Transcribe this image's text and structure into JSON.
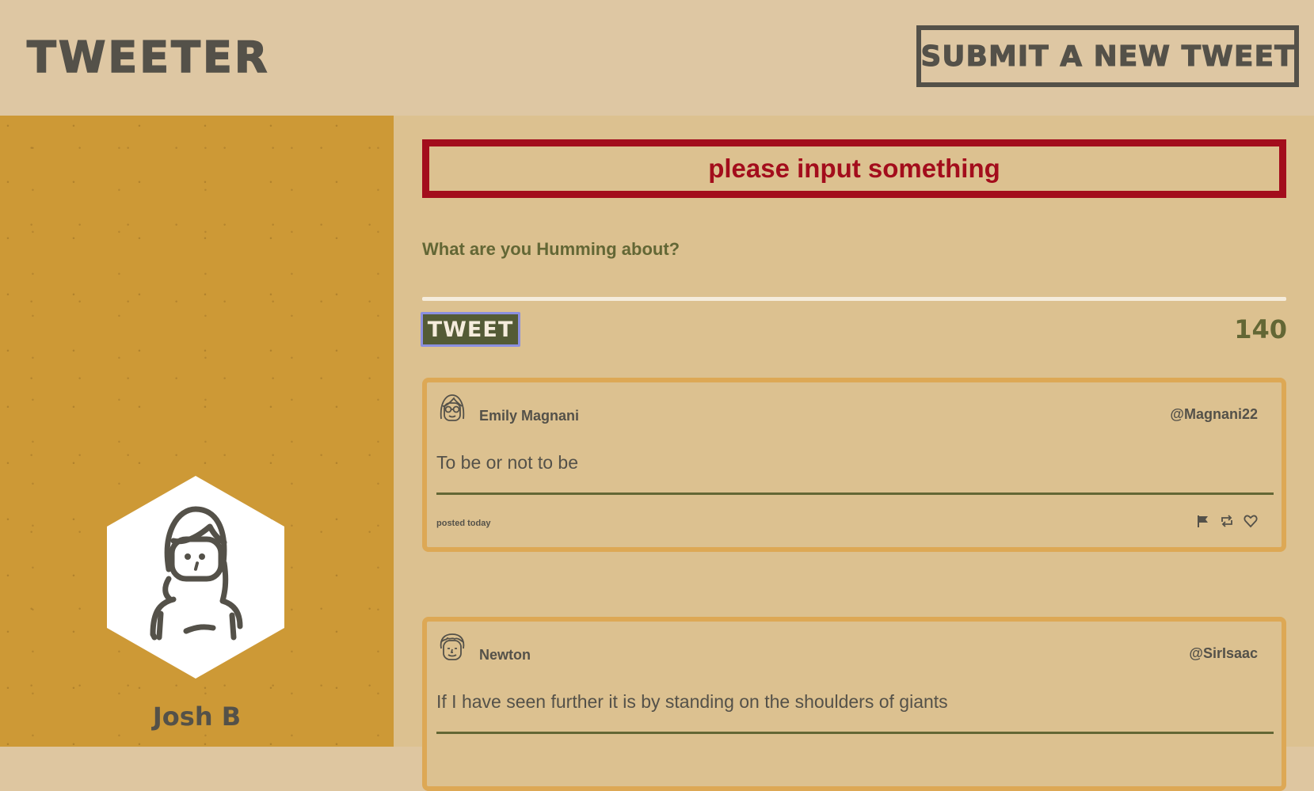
{
  "header": {
    "brand": "TWEETER",
    "compose_label": "SUBMIT A NEW TWEET"
  },
  "sidebar": {
    "user_name": "Josh B",
    "avatar_icon": "woman-avatar-icon"
  },
  "composer": {
    "error": "please input something",
    "prompt": "What are you Humming about?",
    "input_value": "",
    "tweet_label": "TWEET",
    "char_count": "140"
  },
  "tweets": [
    {
      "name": "Emily Magnani",
      "handle": "@Magnani22",
      "text": "To be or not to be",
      "time": "posted today",
      "avatar_icon": "glasses-woman-avatar-icon"
    },
    {
      "name": "Newton",
      "handle": "@SirIsaac",
      "text": "If I have seen further it is by standing on the shoulders of giants",
      "avatar_icon": "newton-avatar-icon"
    }
  ],
  "colors": {
    "header_bg": "#dec7a3",
    "sidebar_bg": "#cd9936",
    "main_bg": "#dcc190",
    "error": "#a30d1c",
    "olive": "#636735",
    "text_dark": "#545149"
  }
}
